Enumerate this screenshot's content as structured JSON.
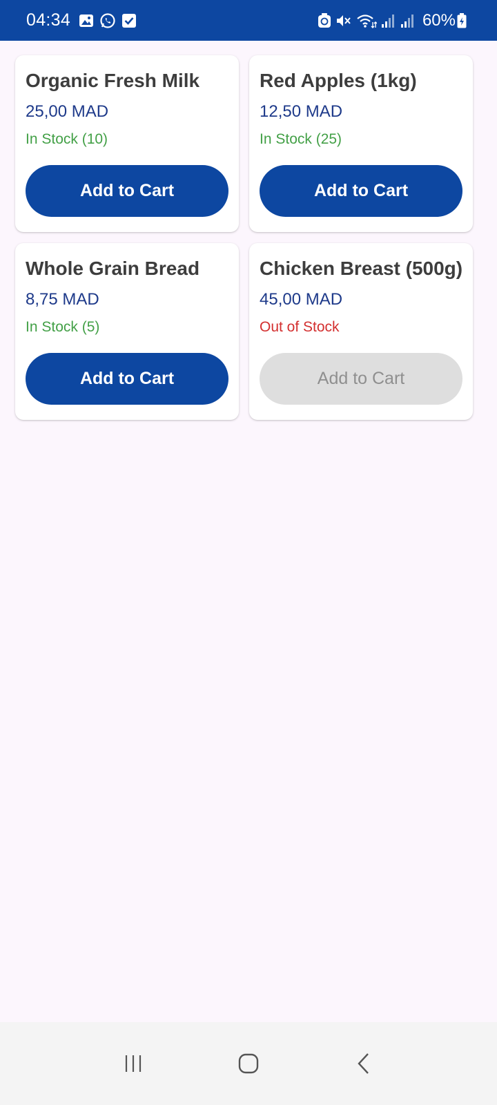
{
  "status_bar": {
    "time": "04:34",
    "battery": "60%",
    "left_icons": [
      "gallery-icon",
      "whatsapp-icon",
      "checkbox-icon"
    ],
    "right_icons": [
      "recycle-icon",
      "mute-icon",
      "wifi-icon",
      "signal-icon",
      "signal-icon",
      "battery-icon"
    ],
    "background_color": "#0d47a1"
  },
  "products": [
    {
      "name": "Organic Fresh Milk",
      "price": "25,00 MAD",
      "stock": "In Stock (10)",
      "in_stock": true,
      "button": "Add to Cart"
    },
    {
      "name": "Red Apples (1kg)",
      "price": "12,50 MAD",
      "stock": "In Stock (25)",
      "in_stock": true,
      "button": "Add to Cart"
    },
    {
      "name": "Whole Grain Bread",
      "price": "8,75 MAD",
      "stock": "In Stock (5)",
      "in_stock": true,
      "button": "Add to Cart"
    },
    {
      "name": "Chicken Breast (500g)",
      "price": "45,00 MAD",
      "stock": "Out of Stock",
      "in_stock": false,
      "button": "Add to Cart"
    }
  ],
  "colors": {
    "primary": "#0d47a1",
    "price": "#1e3a8a",
    "in_stock": "#43a047",
    "out_of_stock": "#d32f2f",
    "disabled_button": "#dedede"
  },
  "nav_bar": {
    "buttons": [
      "recent-apps-icon",
      "home-icon",
      "back-icon"
    ]
  }
}
